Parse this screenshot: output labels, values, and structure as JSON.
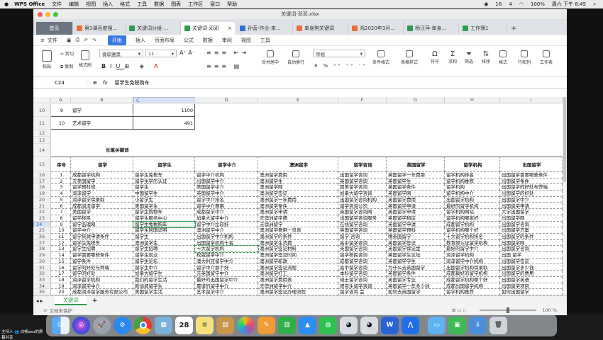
{
  "mac_menubar": {
    "app_name": "WPS Office",
    "menus": [
      "文件",
      "编辑",
      "视图",
      "插入",
      "格式",
      "工具",
      "数据",
      "图表",
      "工作区",
      "窗口",
      "帮助"
    ],
    "status": {
      "count": "16",
      "count2": "4",
      "battery": "100%",
      "datetime": "周六 下午 8:45"
    }
  },
  "window": {
    "title": "关键词-邓邓.xlsx",
    "tabs": [
      {
        "label": "首页",
        "kind": "home"
      },
      {
        "label": "第3课百度搜...",
        "color": "#e8703a"
      },
      {
        "label": "关键词分组-...",
        "color": "#2f9b4f"
      },
      {
        "label": "关键词-邓邓",
        "color": "#2f9b4f",
        "active": true
      },
      {
        "label": "孙营-作业-来...",
        "color": "#2f6fd6"
      },
      {
        "label": "单身狗关键词",
        "color": "#e8703a"
      },
      {
        "label": "鸿2020年3月...",
        "color": "#e8703a"
      },
      {
        "label": "杨汪萍-单身...",
        "color": "#2f9b4f"
      },
      {
        "label": "工作簿1",
        "color": "#2f9b4f"
      }
    ]
  },
  "menu": {
    "file": "文件",
    "items": [
      "开始",
      "插入",
      "页面布局",
      "公式",
      "数据",
      "审阅",
      "视图",
      "工具"
    ]
  },
  "ribbon": {
    "paste": "粘贴",
    "cut": "剪切",
    "copy": "复制",
    "format_painter": "格式刷",
    "font_name": "微软雅黑",
    "font_size": "11",
    "merge": "合并居中",
    "wrap": "自动换行",
    "number_format": "常规",
    "cond_format": "条件格式",
    "table_style": "表格样式",
    "symbol": "符号",
    "sum": "求和",
    "filter": "筛选",
    "sort": "排序",
    "format": "格式",
    "rowcol": "行和列",
    "worksheet": "工作表"
  },
  "formula_bar": {
    "cell_ref": "C24",
    "fx": "fx",
    "value": "留学生免税购车"
  },
  "columns": [
    "A",
    "B",
    "C",
    "D",
    "E",
    "F",
    "G",
    "H",
    "I"
  ],
  "top_rows": [
    {
      "row": "10",
      "a": "9",
      "b": "留学",
      "c": "1100"
    },
    {
      "row": "11",
      "a": "10",
      "b": "艺术留学",
      "c": "491"
    }
  ],
  "section_title": {
    "row": "14",
    "text": "长尾关键词"
  },
  "header_row": {
    "row": "15",
    "cells": [
      "序号",
      "留学",
      "留学生",
      "留学中介",
      "澳洲留学",
      "留学咨询",
      "英国留学",
      "留学机构",
      "出国留学"
    ]
  },
  "data_rows": [
    {
      "row": "16",
      "cells": [
        "1",
        "成都留学机构",
        "留学生免税车",
        "留学中介机构",
        "澳洲留学费用",
        "出国留学咨询",
        "英国留学一年费用",
        "留学机构排名",
        "出国留学需要哪些条件"
      ]
    },
    {
      "row": "17",
      "cells": [
        "2",
        "去美国留学",
        "留学生学历认证",
        "出国留学中介",
        "澳洲留学生",
        "英国留学咨询",
        "英国留学生",
        "留学机构推荐",
        "出国留学条件"
      ]
    },
    {
      "row": "18",
      "cells": [
        "3",
        "留学预科班",
        "留学生",
        "美国留学中介",
        "澳洲留学网",
        "因美留学咨询",
        "英国留学条件",
        "留学机构",
        "出国留学的好处与弊端"
      ]
    },
    {
      "row": "19",
      "cells": [
        "4",
        "润泽留学",
        "中国留学生",
        "英国留学中介",
        "澳洲留学签证",
        "加拿大留学咨询",
        "英国留学网",
        "留学机构中介",
        "出国留学的好处"
      ]
    },
    {
      "row": "20",
      "cells": [
        "5",
        "润泽留学保录取",
        "小留学生",
        "留学中介排名",
        "澳洲留学一年费用",
        "出国留学咨询机构",
        "英国留学费用",
        "出国留学机构",
        "出国留学中介"
      ]
    },
    {
      "row": "21",
      "cells": [
        "6",
        "成都润泽留学",
        "美国留学生",
        "留学中介费用",
        "澳洲留学条件",
        "留学咨询公司",
        "英国留学申请",
        "最好的留学机构",
        "出国留学申请"
      ]
    },
    {
      "row": "22",
      "cells": [
        "7",
        "美国留学",
        "留学生购物车",
        "成都留学中介",
        "澳洲留学申请",
        "英国留学咨询网",
        "英国留学申请",
        "留学机构网站",
        "大学出国留学"
      ]
    },
    {
      "row": "23",
      "cells": [
        "8",
        "留学移民",
        "留学生服务中心",
        "加拿大留学中介",
        "去澳洲留学费",
        "出国留学咨询服务",
        "英国留学租房",
        "留学机构哪家好",
        "出国留学网"
      ]
    },
    {
      "row": "24",
      "cells": [
        "9",
        "留学监理网",
        "留学生免税购车",
        "留学中介比较好",
        "去澳洲留学",
        "在线留学咨询",
        "英国留学申请",
        "成都留学机构",
        "出国留学咨询"
      ]
    },
    {
      "row": "25",
      "cells": [
        "10",
        "留学中介",
        "留学生回国证明",
        "澳洲留学中介",
        "澳洲留学费用一览表",
        "英国留学咨询",
        "英国留学预科",
        "留学机构哪个好",
        "出国留学方案"
      ]
    },
    {
      "row": "26",
      "cells": [
        "11",
        "留学贷款申请条件",
        "留学生",
        "出国留学中介机构",
        "澳洲留学的条件",
        "留学 咨询",
        "嗜英国留学",
        "十大留学机构排名",
        "出国留学的条件"
      ]
    },
    {
      "row": "27",
      "cells": [
        "12",
        "留学生免税车",
        "澳洲留学生",
        "出国留学机构十名",
        "澳洲留学生消费",
        "高中留学咨询",
        "英国留学签证",
        "教育部认证留学机构",
        "出国留学网"
      ]
    },
    {
      "row": "28",
      "cells": [
        "13",
        "留学生招聘",
        "留学生招聘",
        "十大留学机构",
        "澳洲留学签证材料",
        "英国留学咨询",
        "英国留学保证金",
        "最好的留学中介",
        "出国留学咨询"
      ]
    },
    {
      "row": "29",
      "cells": [
        "14",
        "留学需要哪些条件",
        "留学生就业",
        "权威留学中介",
        "澳洲留学签证时间",
        "留学移民咨询",
        "英国留学生论坛",
        "润泽留学机构",
        "出国 留学"
      ]
    },
    {
      "row": "30",
      "cells": [
        "15",
        "留学条件",
        "留学生论坛",
        "澳大利亚留学中介",
        "澳洲留学新政",
        "成都留学咨询",
        "英国留学学生",
        "润泽留学中介机构",
        "出国留学签证"
      ]
    },
    {
      "row": "31",
      "cells": [
        "16",
        "留学的好处与弊端",
        "留学生中介",
        "留学中介那个好",
        "澳洲留学签证流程",
        "高中留学咨询",
        "为什么去英国留学",
        "出国留学机构保录取",
        "出国留学多少钱"
      ]
    },
    {
      "row": "32",
      "cells": [
        "17",
        "留学的好处",
        "加拿大留学生",
        "去英国留学中介",
        "澳洲留学打工",
        "本科留学咨询",
        "英国留学条件",
        "成都最好的留学机构",
        "出国留学的费用"
      ]
    },
    {
      "row": "33",
      "cells": [
        "18",
        "润泽留学机构",
        "我们的留学生活",
        "最好的出国留学中介",
        "澳洲留学费用表",
        "硕士留学咨询",
        "英国留学专业",
        "成都留学机构哪个好",
        "出国留学英语"
      ]
    },
    {
      "row": "34",
      "cells": [
        "19",
        "润泽留学中介",
        "新加坡留学生",
        "靠谱的留学中介",
        "去澳洲留学中介",
        "研究生留学咨询",
        "英国留学一年多少钱",
        "成都出国留学机构",
        "出国留学项目"
      ]
    },
    {
      "row": "35",
      "cells": [
        "20",
        "成都润泽留学服务有限公司",
        "美国留学生活",
        "艺术留学中介",
        "澳洲留学签证办理流程",
        "留学咨询 会",
        "如何去英国留学",
        "留学机构推荐",
        "如何出国留学"
      ]
    }
  ],
  "sheet_tab": "关键词",
  "status_bar": {
    "protect": "文档未保护",
    "zoom": "100 %"
  },
  "dock_apps": [
    "finder",
    "siri",
    "launchpad",
    "safari",
    "chrome",
    "preview",
    "calendar",
    "notes",
    "maps",
    "photos",
    "pages",
    "numbers",
    "keynote",
    "wechat",
    "qq",
    "qq2",
    "wps",
    "feishu",
    "folder",
    "facetime",
    "trash"
  ],
  "calendar_day": "28",
  "webcam_label": "主持人 👥 白畅seo的屏幕共享"
}
